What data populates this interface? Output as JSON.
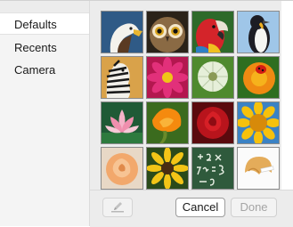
{
  "sidebar": {
    "items": [
      {
        "label": "Defaults",
        "selected": true
      },
      {
        "label": "Recents",
        "selected": false
      },
      {
        "label": "Camera",
        "selected": false
      }
    ]
  },
  "grid": {
    "images": [
      "eagle",
      "owl",
      "parrot",
      "penguin",
      "zebra",
      "pink-dahlia",
      "dandelion",
      "ladybug-flower",
      "lotus",
      "orange-poppy",
      "red-rose",
      "sunflower",
      "peach-rose",
      "yellow-daisy",
      "chalkboard",
      "fortune-cookie"
    ]
  },
  "toolbar": {
    "edit_icon": "pencil-icon",
    "cancel_label": "Cancel",
    "done_label": "Done",
    "done_enabled": false
  },
  "colors": {
    "selected_row": "#ffffff",
    "sidebar_bg": "#f4f4f4",
    "panel_bg": "#ececec"
  }
}
